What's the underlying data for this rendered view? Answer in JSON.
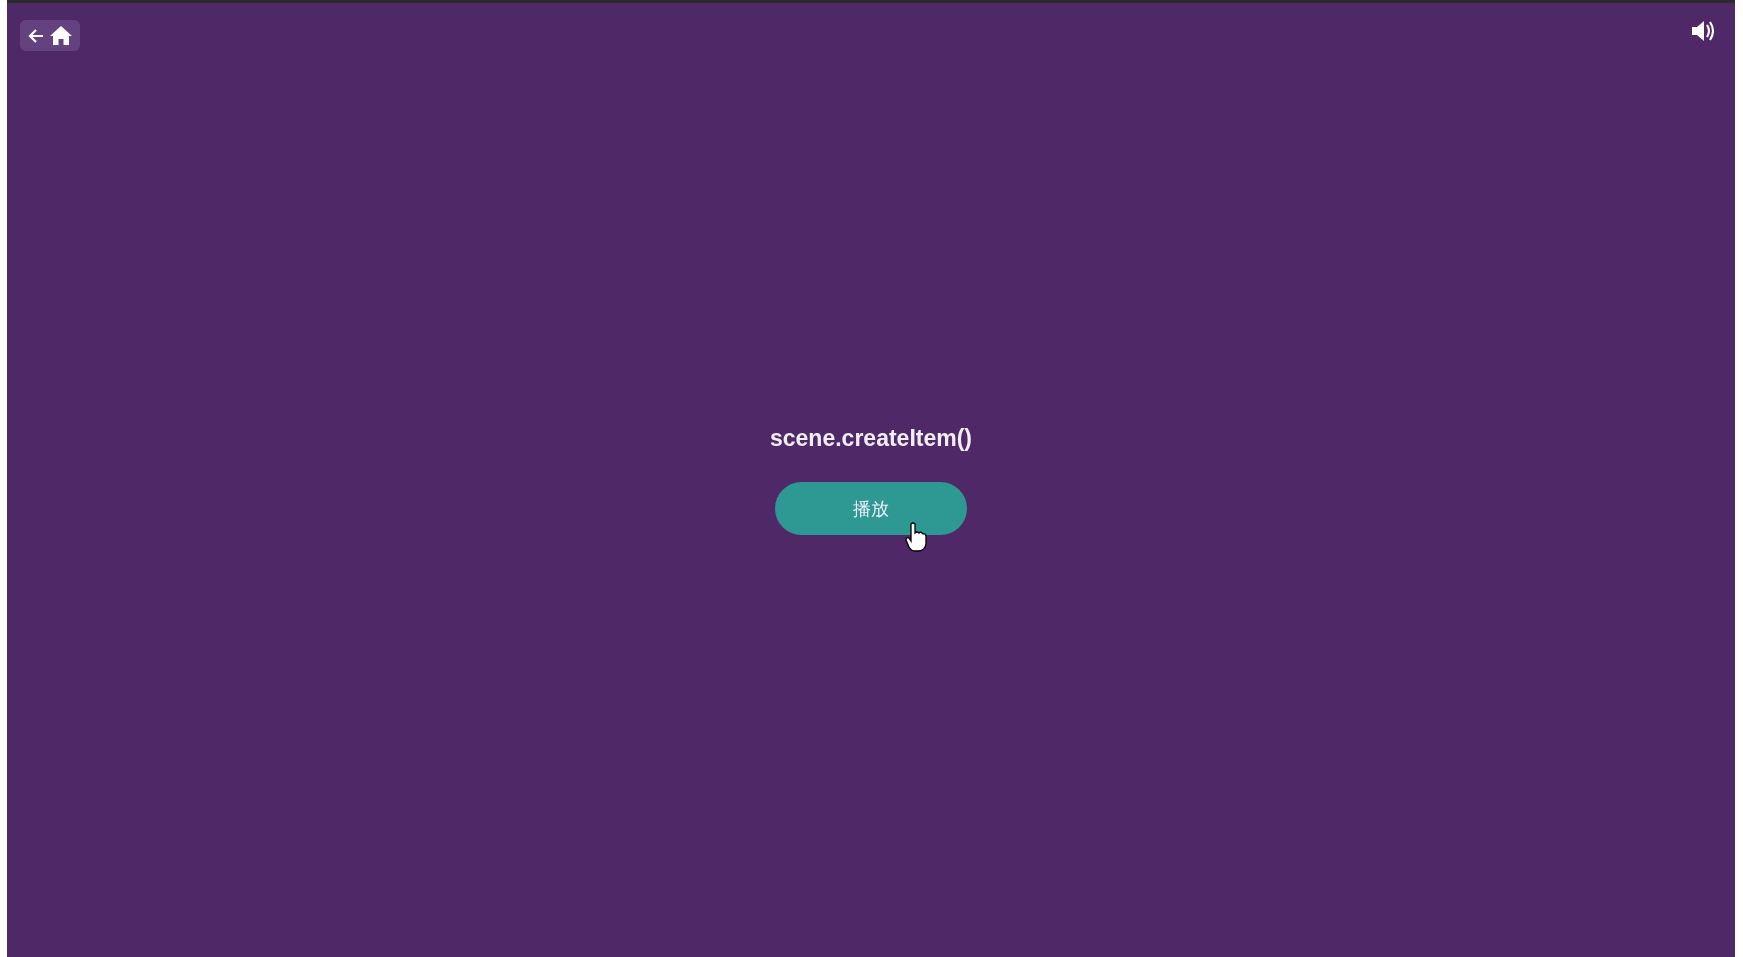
{
  "title": "scene.createItem()",
  "play_button": {
    "label": "播放"
  }
}
